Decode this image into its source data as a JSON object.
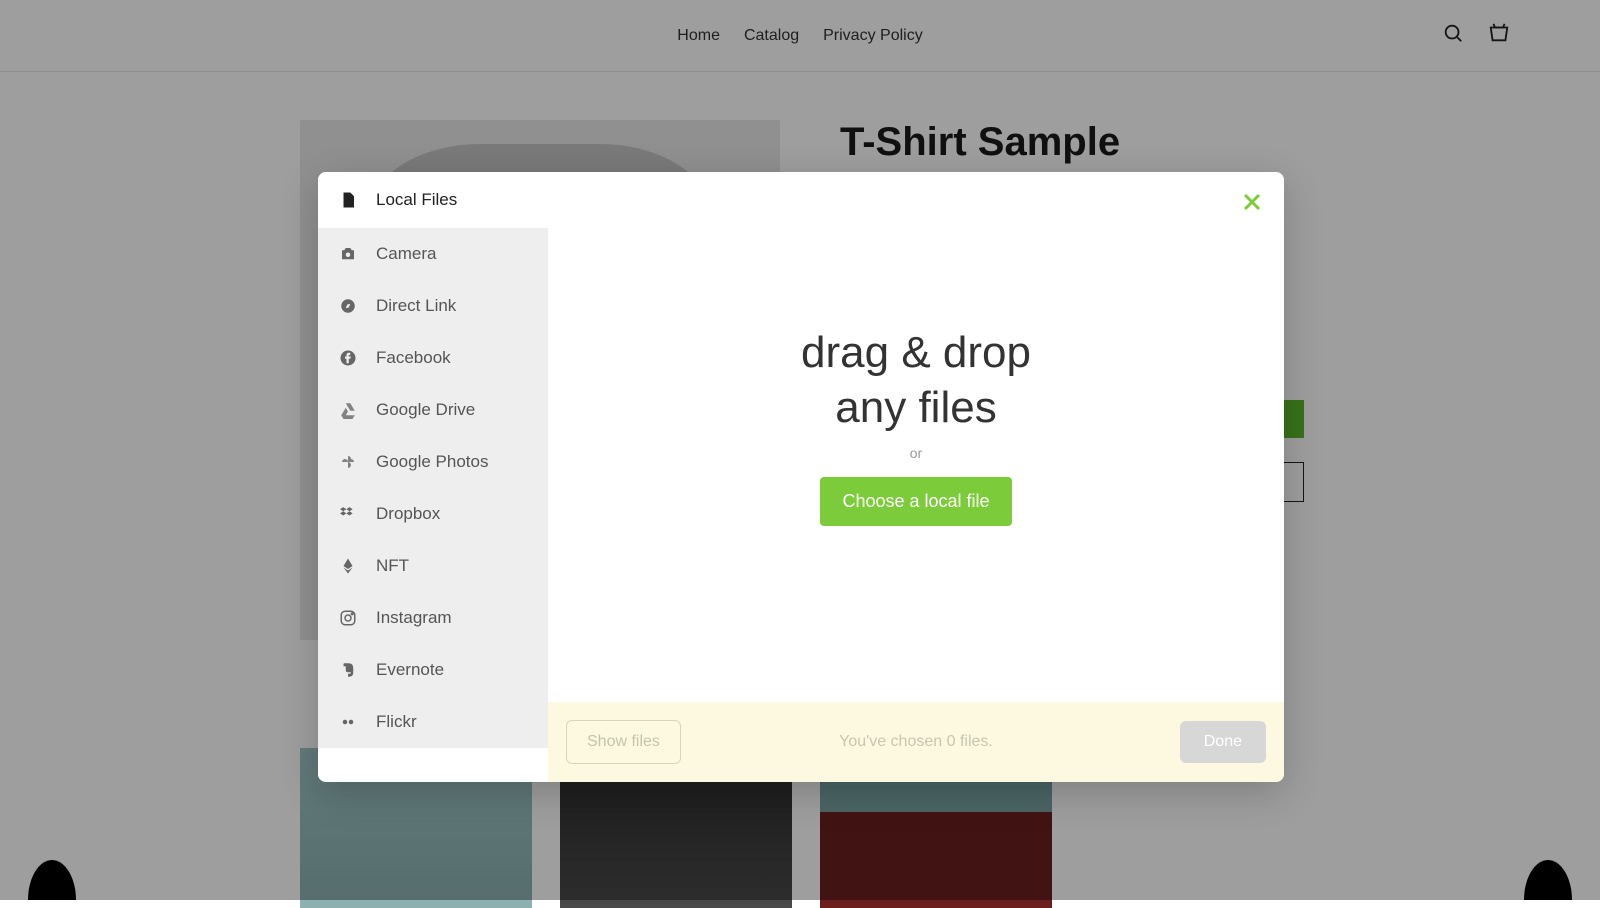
{
  "header": {
    "nav": [
      "Home",
      "Catalog",
      "Privacy Policy"
    ]
  },
  "product": {
    "title": "T-Shirt Sample"
  },
  "dialog": {
    "sources": [
      {
        "label": "Local Files",
        "icon": "file-icon",
        "active": true
      },
      {
        "label": "Camera",
        "icon": "camera-icon",
        "active": false
      },
      {
        "label": "Direct Link",
        "icon": "compass-icon",
        "active": false
      },
      {
        "label": "Facebook",
        "icon": "facebook-icon",
        "active": false
      },
      {
        "label": "Google Drive",
        "icon": "google-drive-icon",
        "active": false
      },
      {
        "label": "Google Photos",
        "icon": "google-photos-icon",
        "active": false
      },
      {
        "label": "Dropbox",
        "icon": "dropbox-icon",
        "active": false
      },
      {
        "label": "NFT",
        "icon": "ethereum-icon",
        "active": false
      },
      {
        "label": "Instagram",
        "icon": "instagram-icon",
        "active": false
      },
      {
        "label": "Evernote",
        "icon": "evernote-icon",
        "active": false
      },
      {
        "label": "Flickr",
        "icon": "flickr-icon",
        "active": false
      }
    ],
    "drop": {
      "line1": "drag & drop",
      "line2": "any files",
      "or": "or",
      "choose_button": "Choose a local file"
    },
    "footer": {
      "show_files": "Show files",
      "status": "You've chosen 0 files.",
      "done": "Done"
    }
  },
  "colors": {
    "accent_green": "#7bcb3a",
    "footer_bg": "#fdf9e0"
  }
}
